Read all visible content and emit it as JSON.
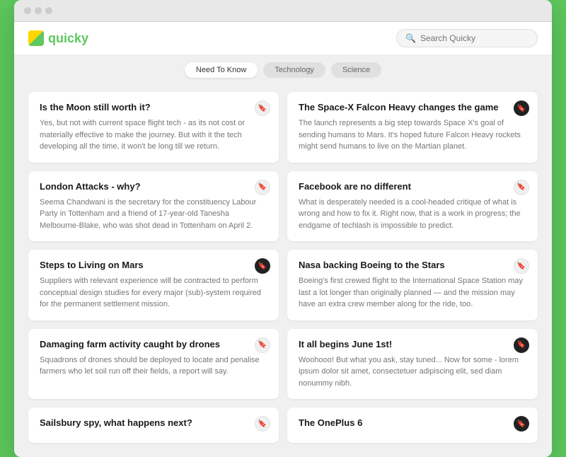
{
  "logo": {
    "text": "quicky"
  },
  "search": {
    "placeholder": "Search Quicky"
  },
  "tabs": [
    {
      "id": "need-to-know",
      "label": "Need To Know",
      "active": true
    },
    {
      "id": "technology",
      "label": "Technology",
      "active": false
    },
    {
      "id": "science",
      "label": "Science",
      "active": false
    }
  ],
  "cards": [
    {
      "id": "card-1",
      "title": "Is the Moon still worth it?",
      "body": "Yes, but not with current space flight tech - as its not cost or materially effective to make the journey. But with it the tech developing all the time, it won't be long till we return.",
      "badge": "light",
      "badge_icon": "▲"
    },
    {
      "id": "card-2",
      "title": "The Space-X Falcon Heavy changes the game",
      "body": "The launch represents a big step towards Space X's goal of sending humans to Mars. It's hoped future Falcon Heavy rockets might send humans to live on the Martian planet.",
      "badge": "dark",
      "badge_icon": "▲"
    },
    {
      "id": "card-3",
      "title": "London Attacks - why?",
      "body": "Seema Chandwani is the secretary for the constituency Labour Party in Tottenham and a friend of 17-year-old Tanesha Melbourne-Blake, who was shot dead in Tottenham on April 2.",
      "badge": "light",
      "badge_icon": "▲"
    },
    {
      "id": "card-4",
      "title": "Facebook are no different",
      "body": "What is desperately needed is a cool-headed critique of what is wrong and how to fix it. Right now, that is a work in progress; the endgame of techlash is impossible to predict.",
      "badge": "light",
      "badge_icon": "▲"
    },
    {
      "id": "card-5",
      "title": "Steps to Living on Mars",
      "body": "Suppliers with relevant experience will be contracted to perform conceptual design studies for every major (sub)-system required for the permanent settlement mission.",
      "badge": "dark",
      "badge_icon": "▲"
    },
    {
      "id": "card-6",
      "title": "Nasa backing Boeing to the Stars",
      "body": "Boeing's first crewed flight to the International Space Station may last a lot longer than originally planned — and the mission may have an extra crew member along for the ride, too.",
      "badge": "light",
      "badge_icon": "▲"
    },
    {
      "id": "card-7",
      "title": "Damaging farm activity caught by drones",
      "body": "Squadrons of drones should be deployed to locate and penalise farmers who let soil run off their fields, a report will say.",
      "badge": "light",
      "badge_icon": "▲"
    },
    {
      "id": "card-8",
      "title": "It all begins June 1st!",
      "body": "Woohooo! But what you ask, stay tuned... Now for some - lorem ipsum dolor sit amet, consectetuer adipiscing elit, sed diam nonummy nibh.",
      "badge": "dark",
      "badge_icon": "▲"
    },
    {
      "id": "card-9",
      "title": "Sailsbury spy, what happens next?",
      "body": "",
      "badge": "light",
      "badge_icon": "▲"
    },
    {
      "id": "card-10",
      "title": "The OnePlus 6",
      "body": "",
      "badge": "dark",
      "badge_icon": "▲"
    }
  ]
}
